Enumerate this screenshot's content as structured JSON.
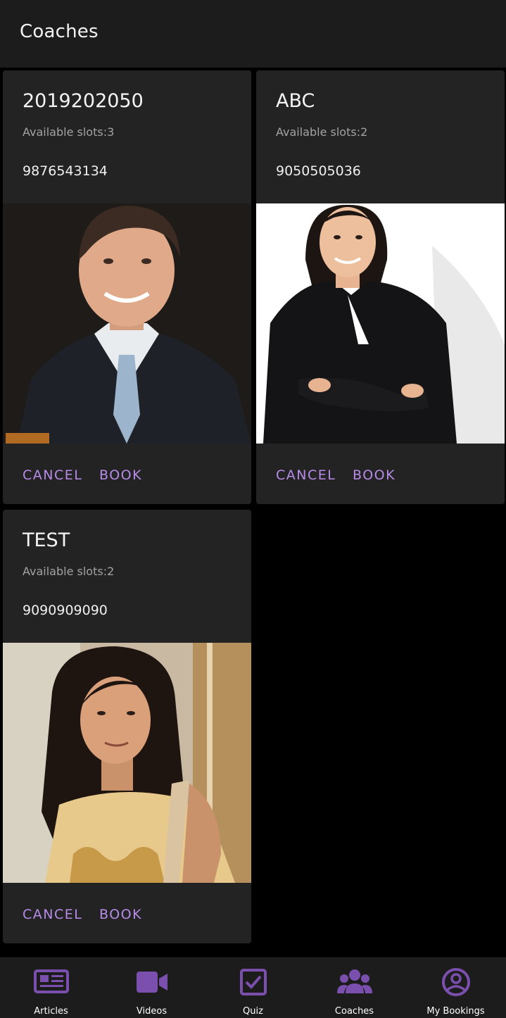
{
  "app_bar": {
    "title": "Coaches"
  },
  "coaches": [
    {
      "name": "2019202050",
      "slots": "Available slots:3",
      "phone": "9876543134",
      "cancel_label": "CANCEL",
      "book_label": "BOOK"
    },
    {
      "name": "ABC",
      "slots": "Available slots:2",
      "phone": "9050505036",
      "cancel_label": "CANCEL",
      "book_label": "BOOK"
    },
    {
      "name": "TEST",
      "slots": "Available slots:2",
      "phone": "9090909090",
      "cancel_label": "CANCEL",
      "book_label": "BOOK"
    }
  ],
  "bottom_nav": {
    "items": [
      {
        "label": "Articles",
        "icon": "newspaper-icon"
      },
      {
        "label": "Videos",
        "icon": "video-camera-icon"
      },
      {
        "label": "Quiz",
        "icon": "checkbox-icon"
      },
      {
        "label": "Coaches",
        "icon": "people-group-icon"
      },
      {
        "label": "My Bookings",
        "icon": "account-circle-icon"
      }
    ]
  },
  "colors": {
    "accent": "#b78ce8",
    "icon": "#7b4fae",
    "background": "#000000",
    "surface": "#232323",
    "bar": "#1c1c1c"
  }
}
